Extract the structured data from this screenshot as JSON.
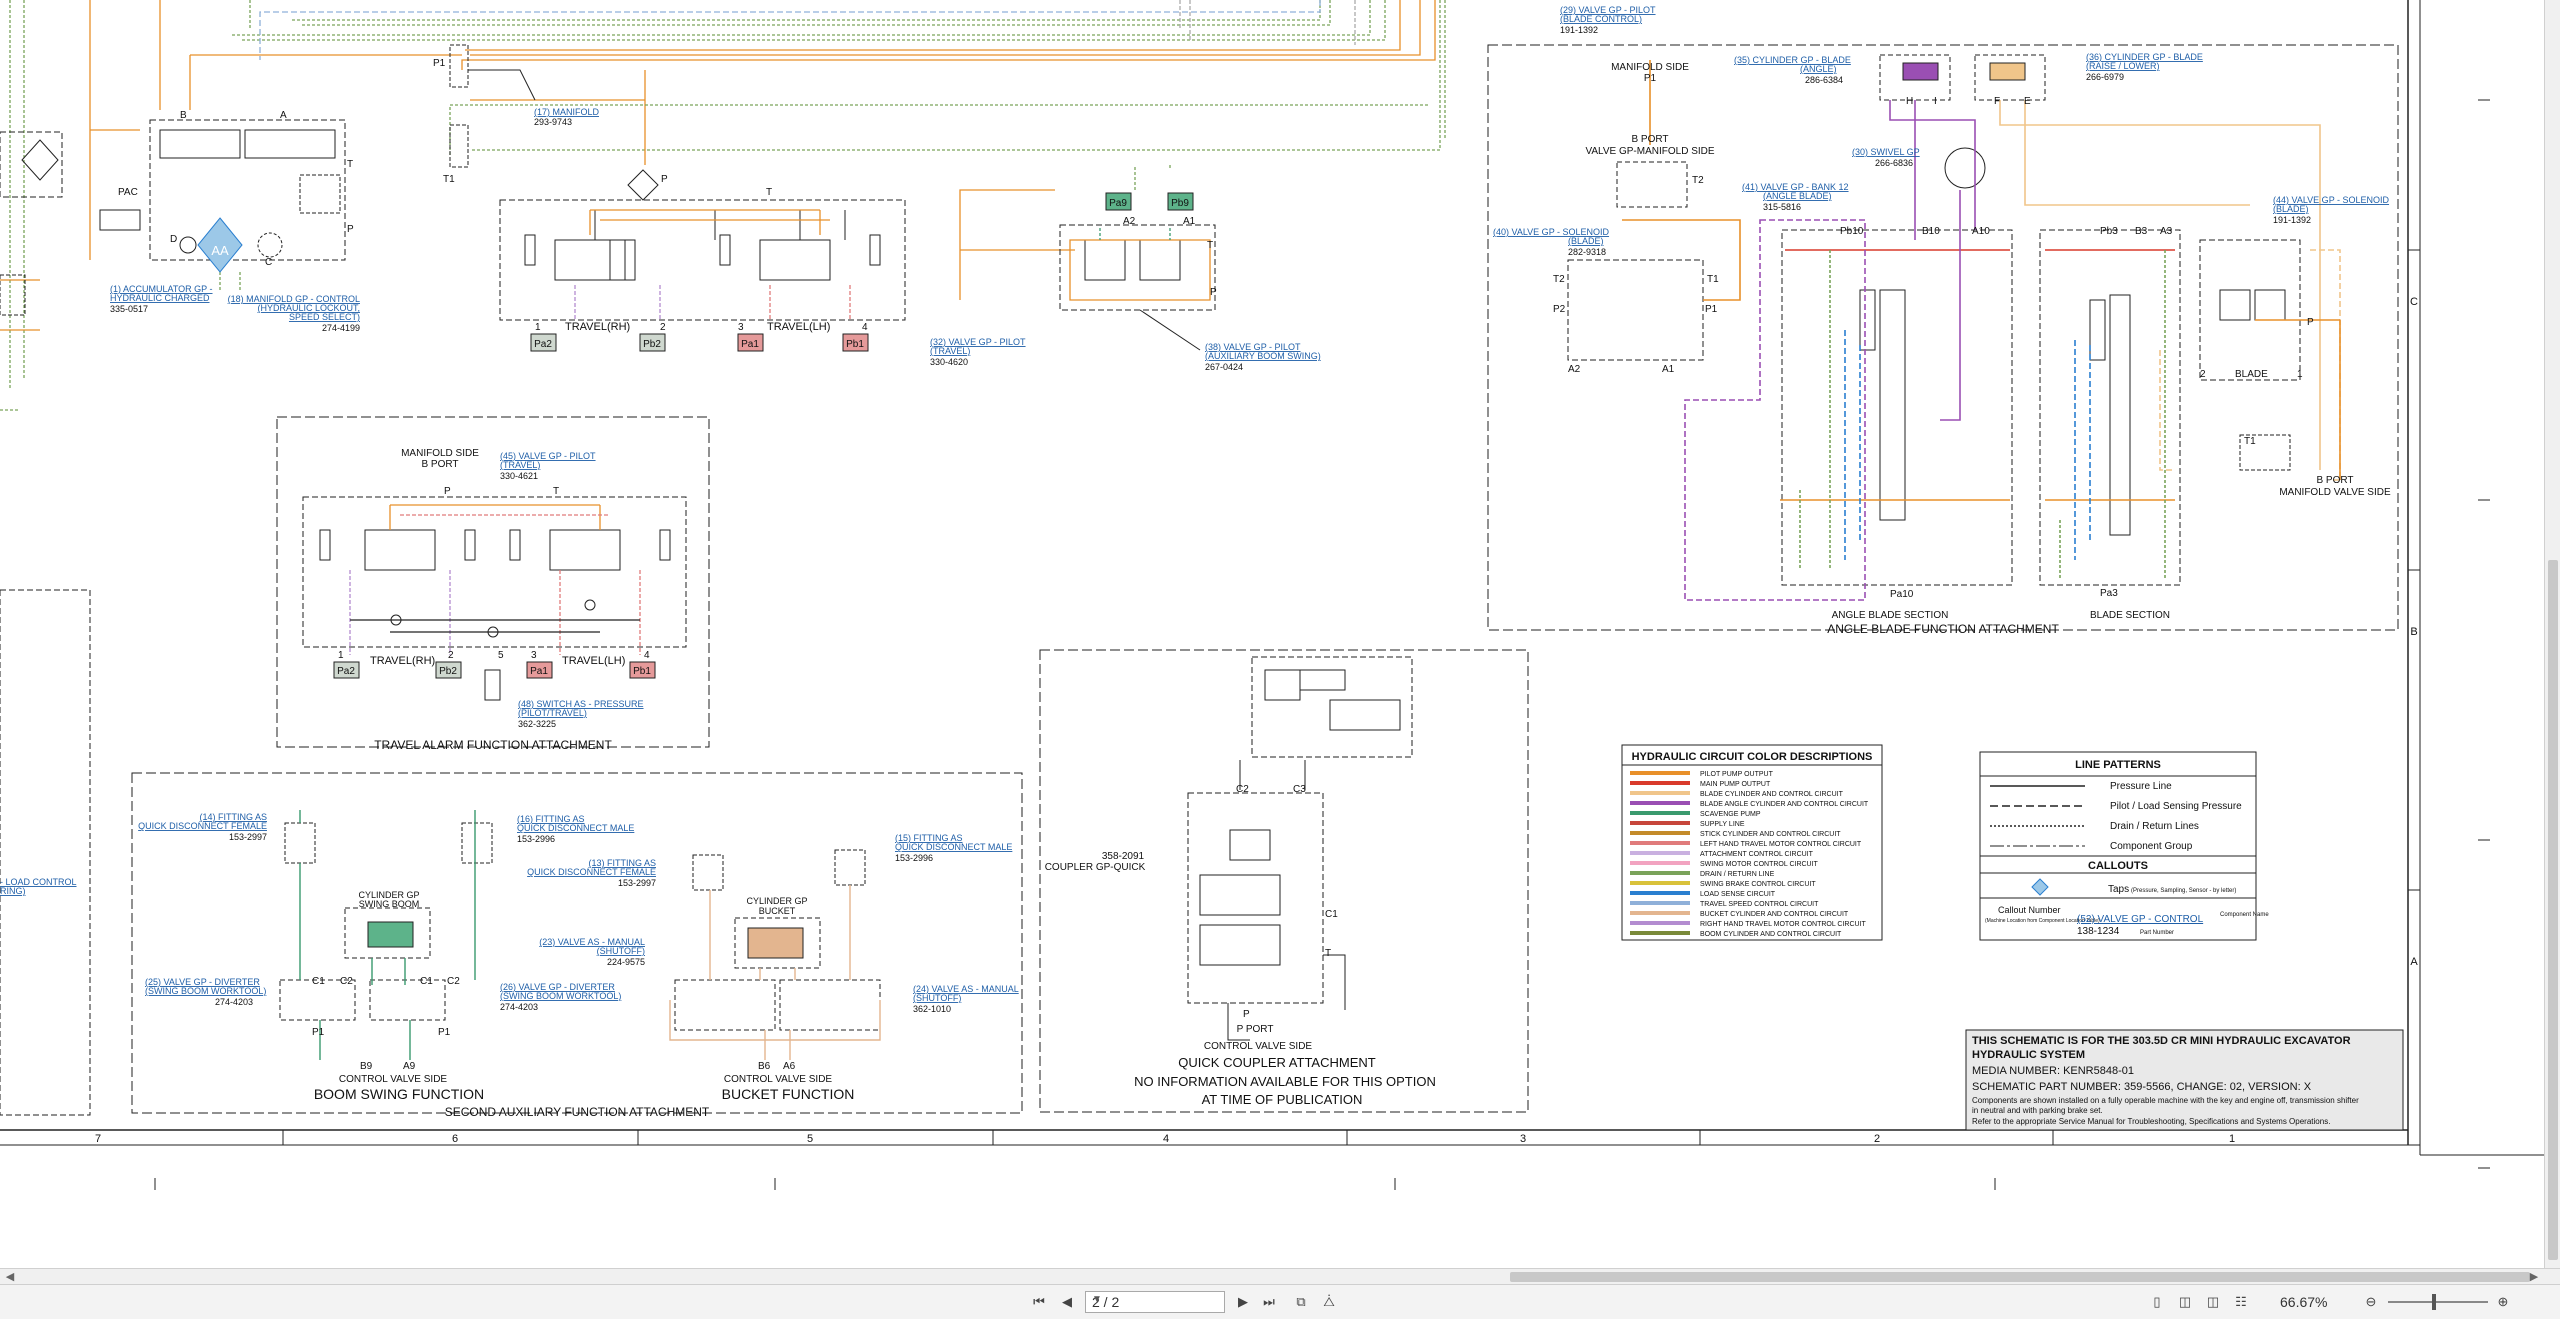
{
  "schematic": {
    "top_blade_pilot": {
      "link": "(29) VALVE GP - PILOT",
      "link2": "(BLADE CONTROL)",
      "part": "191-1392"
    },
    "accumulator": {
      "label": "PAC",
      "link": "(1) ACCUMULATOR GP -",
      "link2": "HYDRAULIC CHARGED",
      "part": "335-0517"
    },
    "aa_label": "AA",
    "manifold_lockout": {
      "link": "(18) MANIFOLD GP - CONTROL",
      "link2": "(HYDRAULIC LOCKOUT,",
      "link3": "SPEED SELECT)",
      "part": "274-4199"
    },
    "manifold17": {
      "link": "(17) MANIFOLD",
      "part": "293-9743"
    },
    "ports": {
      "p1": "P1",
      "t1": "T1",
      "p": "P",
      "t": "T",
      "a": "A",
      "b": "B",
      "c": "C",
      "d": "D"
    },
    "travel_top": {
      "rh": "TRAVEL(RH)",
      "lh": "TRAVEL(LH)",
      "pa2": "Pa2",
      "pb2": "Pb2",
      "pa1": "Pa1",
      "pb1": "Pb1",
      "n1": "1",
      "n2": "2",
      "n3": "3",
      "n4": "4"
    },
    "pilot_travel": {
      "link": "(32) VALVE GP - PILOT",
      "link2": "(TRAVEL)",
      "part": "330-4620"
    },
    "aux_boom": {
      "pa9": "Pa9",
      "pb9": "Pb9",
      "a2": "A2",
      "a1": "A1",
      "link": "(38) VALVE GP - PILOT",
      "link2": "(AUXILIARY BOOM SWING)",
      "part": "267-0424"
    },
    "angle_blade": {
      "manifold_side": "MANIFOLD SIDE",
      "p1": "P1",
      "bport": "B PORT",
      "valve_side": "VALVE GP-MANIFOLD SIDE",
      "t2": "T2",
      "cyl_angle_link": "(35) CYLINDER GP - BLADE",
      "cyl_angle_link2": "(ANGLE)",
      "cyl_angle_part": "286-6384",
      "cyl_raise_link": "(36) CYLINDER GP - BLADE",
      "cyl_raise_link2": "(RAISE / LOWER)",
      "cyl_raise_part": "266-6979",
      "h": "H",
      "i": "I",
      "f": "F",
      "e": "E",
      "swivel_link": "(30) SWIVEL GP",
      "swivel_part": "266-6836",
      "bank_link": "(41) VALVE GP - BANK 12",
      "bank_link2": "(ANGLE BLADE)",
      "bank_part": "315-5816",
      "sol_link": "(40) VALVE GP - SOLENOID",
      "sol_link2": "(BLADE)",
      "sol_part": "282-9318",
      "sol2_link": "(44) VALVE GP - SOLENOID",
      "sol2_link2": "(BLADE)",
      "sol2_part": "191-1392",
      "pb10": "Pb10",
      "b10": "B10",
      "a10": "A10",
      "pb3": "Pb3",
      "b3": "B3",
      "a3": "A3",
      "pa10": "Pa10",
      "pa3": "Pa3",
      "a2": "A2",
      "a1": "A1",
      "p2": "P2",
      "t1": "T1",
      "blade": "BLADE",
      "n1": "1",
      "n2": "2",
      "bport2": "B PORT",
      "manifold_valve_side": "MANIFOLD VALVE SIDE",
      "angle_section": "ANGLE BLADE SECTION",
      "blade_section": "BLADE SECTION",
      "title": "ANGLE BLADE FUNCTION ATTACHMENT"
    },
    "travel_alarm": {
      "manifold_side": "MANIFOLD SIDE",
      "bport": "B PORT",
      "link": "(45) VALVE GP - PILOT",
      "link2": "(TRAVEL)",
      "part": "330-4621",
      "p": "P",
      "t": "T",
      "rh": "TRAVEL(RH)",
      "lh": "TRAVEL(LH)",
      "pa2": "Pa2",
      "pb2": "Pb2",
      "pa1": "Pa1",
      "pb1": "Pb1",
      "n1": "1",
      "n2": "2",
      "n3": "3",
      "n4": "4",
      "n5": "5",
      "sw_link": "(48) SWITCH AS - PRESSURE",
      "sw_link2": "(PILOT/TRAVEL)",
      "sw_part": "362-3225",
      "title": "TRAVEL ALARM FUNCTION ATTACHMENT"
    },
    "left_cut": {
      "link": "- LOAD CONTROL",
      "link2": "RING)"
    },
    "boom_swing": {
      "f14_link": "(14) FITTING AS",
      "f14_link2": "QUICK DISCONNECT FEMALE",
      "f14_part": "153-2997",
      "f16_link": "(16) FITTING AS",
      "f16_link2": "QUICK DISCONNECT MALE",
      "f16_part": "153-2996",
      "cyl": "CYLINDER GP",
      "cyl2": "SWING BOOM",
      "v25_link": "(25) VALVE GP - DIVERTER",
      "v25_link2": "(SWING BOOM WORKTOOL)",
      "v25_part": "274-4203",
      "v26_link": "(26) VALVE GP - DIVERTER",
      "v26_link2": "(SWING BOOM WORKTOOL)",
      "v26_part": "274-4203",
      "c1": "C1",
      "c2": "C2",
      "p1": "P1",
      "b9": "B9",
      "a9": "A9",
      "cvs": "CONTROL VALVE SIDE",
      "title": "BOOM SWING FUNCTION"
    },
    "bucket": {
      "f13_link": "(13) FITTING AS",
      "f13_link2": "QUICK DISCONNECT FEMALE",
      "f13_part": "153-2997",
      "f15_link": "(15) FITTING AS",
      "f15_link2": "QUICK DISCONNECT MALE",
      "f15_part": "153-2996",
      "cyl": "CYLINDER GP",
      "cyl2": "BUCKET",
      "v23_link": "(23) VALVE AS - MANUAL",
      "v23_link2": "(SHUTOFF)",
      "v23_part": "224-9575",
      "v24_link": "(24) VALVE AS - MANUAL",
      "v24_link2": "(SHUTOFF)",
      "v24_part": "362-1010",
      "b6": "B6",
      "a6": "A6",
      "cvs": "CONTROL VALVE SIDE",
      "title": "BUCKET FUNCTION"
    },
    "second_aux_title": "SECOND AUXILIARY FUNCTION ATTACHMENT",
    "coupler": {
      "c2": "C2",
      "c3": "C3",
      "c1": "C1",
      "t": "T",
      "p": "P",
      "part": "358-2091",
      "label": "COUPLER GP-QUICK",
      "pport": "P PORT",
      "cvs": "CONTROL VALVE SIDE",
      "title": "QUICK COUPLER ATTACHMENT",
      "note1": "NO INFORMATION AVAILABLE FOR THIS OPTION",
      "note2": "AT TIME OF PUBLICATION"
    },
    "color_desc": {
      "title": "HYDRAULIC CIRCUIT COLOR DESCRIPTIONS",
      "rows": [
        {
          "label": "PILOT PUMP OUTPUT",
          "color": "#e8902a"
        },
        {
          "label": "MAIN PUMP OUTPUT",
          "color": "#d93a2b"
        },
        {
          "label": "BLADE CYLINDER AND CONTROL CIRCUIT",
          "color": "#f0c58a"
        },
        {
          "label": "BLADE ANGLE CYLINDER AND CONTROL CIRCUIT",
          "color": "#9a4fb3"
        },
        {
          "label": "SCAVENGE PUMP",
          "color": "#3a9a6e"
        },
        {
          "label": "SUPPLY LINE",
          "color": "#c7463b"
        },
        {
          "label": "STICK CYLINDER AND CONTROL CIRCUIT",
          "color": "#c48b2a"
        },
        {
          "label": "LEFT HAND TRAVEL MOTOR CONTROL CIRCUIT",
          "color": "#e07b7b"
        },
        {
          "label": "ATTACHMENT CONTROL CIRCUIT",
          "color": "#c9b0e0"
        },
        {
          "label": "SWING MOTOR CONTROL CIRCUIT",
          "color": "#f2a3c0"
        },
        {
          "label": "DRAIN / RETURN LINE",
          "color": "#7aa35a"
        },
        {
          "label": "SWING BRAKE CONTROL CIRCUIT",
          "color": "#d9c23a"
        },
        {
          "label": "LOAD SENSE CIRCUIT",
          "color": "#2a7fd0"
        },
        {
          "label": "TRAVEL SPEED CONTROL CIRCUIT",
          "color": "#8fb0d9"
        },
        {
          "label": "BUCKET CYLINDER AND CONTROL CIRCUIT",
          "color": "#e3b58f"
        },
        {
          "label": "RIGHT HAND TRAVEL MOTOR CONTROL CIRCUIT",
          "color": "#b38cd0"
        },
        {
          "label": "BOOM CYLINDER AND CONTROL CIRCUIT",
          "color": "#7a8a3a"
        }
      ]
    },
    "line_patterns": {
      "title": "LINE PATTERNS",
      "rows": [
        "Pressure Line",
        "Pilot / Load Sensing Pressure",
        "Drain / Return Lines",
        "Component Group"
      ],
      "callouts_title": "CALLOUTS",
      "taps": "Taps",
      "taps_note": "(Pressure, Sampling, Sensor - by letter)",
      "callout_number": "Callout Number",
      "callout_note": "(Machine Location from Component Location Table)",
      "example_link": "(52) VALVE GP - CONTROL",
      "example_part": "138-1234",
      "component_name": "Component Name",
      "part_number": "Part Number"
    },
    "info": {
      "line1": "THIS SCHEMATIC IS FOR THE 303.5D CR MINI HYDRAULIC EXCAVATOR",
      "line2": "HYDRAULIC SYSTEM",
      "line3": "MEDIA NUMBER: KENR5848-01",
      "line4": "SCHEMATIC PART NUMBER: 359-5566, CHANGE: 02, VERSION: X",
      "line5": "Components are shown installed on a fully operable machine with the key and engine off, transmission shifter",
      "line6": "in neutral and with parking brake set.",
      "line7": "Refer to the appropriate Service Manual for Troubleshooting, Specifications and Systems Operations."
    },
    "grid": {
      "cols": [
        "7",
        "6",
        "5",
        "4",
        "3",
        "2",
        "1"
      ],
      "rows": [
        "C",
        "B",
        "A"
      ]
    }
  },
  "toolbar": {
    "page": "2 / 2",
    "zoom": "66.67%"
  }
}
